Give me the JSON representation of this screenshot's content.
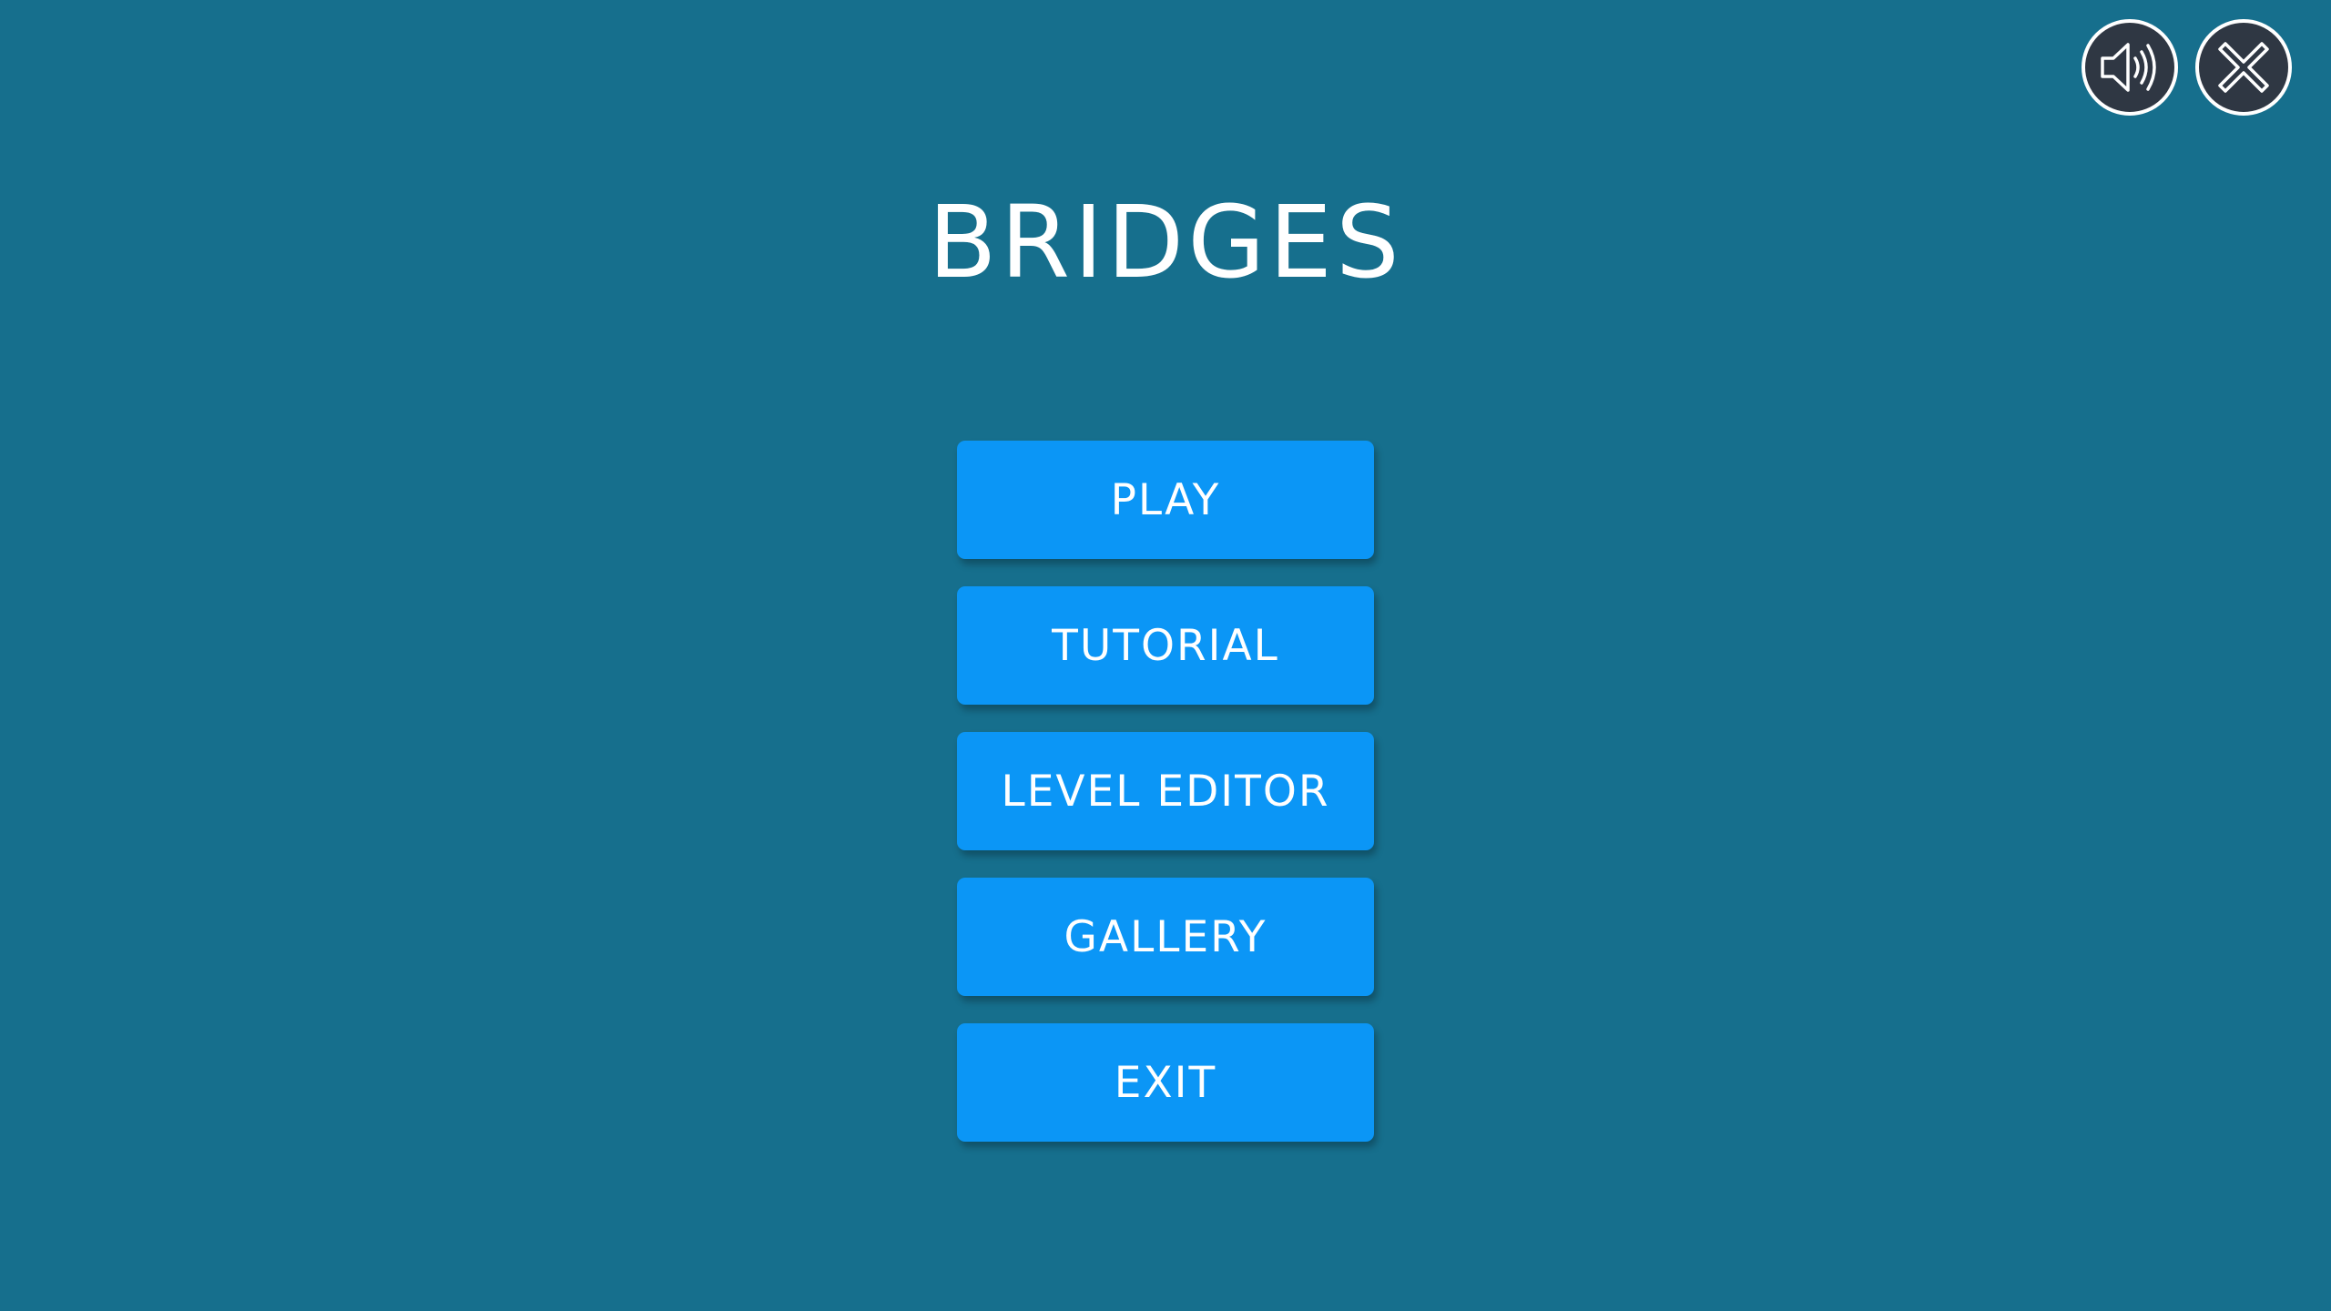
{
  "app": {
    "title": "BRIDGES",
    "background": "#166f8d",
    "accent": "#0b96f6"
  },
  "menu": {
    "items": [
      {
        "label": "PLAY"
      },
      {
        "label": "TUTORIAL"
      },
      {
        "label": "LEVEL EDITOR"
      },
      {
        "label": "GALLERY"
      },
      {
        "label": "EXIT"
      }
    ]
  },
  "corner_controls": {
    "sound_icon": "speaker-icon",
    "close_icon": "close-icon"
  }
}
